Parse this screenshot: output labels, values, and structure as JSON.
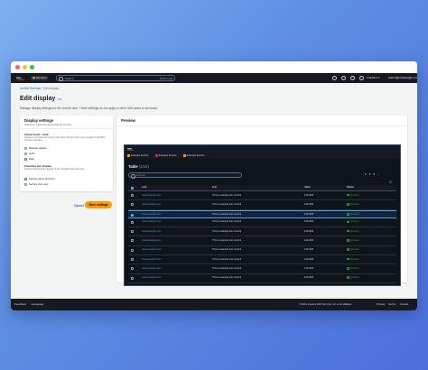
{
  "top_nav": {
    "services": "Services",
    "search_placeholder": "Search",
    "search_shortcut": "[Option+S]",
    "region": "Frankfurt ▾",
    "account": "Admin@nicklaus@m.com ▾"
  },
  "breadcrumb": {
    "root": "Unified Settings",
    "current": "Edit display"
  },
  "page": {
    "title": "Edit display",
    "info": "Info",
    "description": "Manage display settings for the current user. These settings do not apply to other IAM users or accounts."
  },
  "display_settings": {
    "title": "Display settings",
    "subtitle": "Selections made here will update the preview.",
    "visual_mode_label": "Visual mode - beta",
    "visual_mode_hint": "Choose your preferred visual mode. Beta: Visual mode may not apply to all AWS services consoles.",
    "visual_mode_options": [
      "Browser default",
      "Light",
      "Dark"
    ],
    "visual_mode_selected": "Dark",
    "favorites_label": "Favorites bar display",
    "favorites_hint": "Choose how favorites appear in the navigation favorites bar.",
    "favorites_options": [
      "Service name and icon",
      "Service icon only"
    ],
    "favorites_selected": "Service name and icon"
  },
  "actions": {
    "cancel": "Cancel",
    "save": "Save settings"
  },
  "preview": {
    "title": "Preview",
    "tabs": [
      "Example Service",
      "Example Service",
      "Example Service"
    ],
    "table_title": "Table",
    "table_count": "(1/10)",
    "search_placeholder": "Find text",
    "pages": [
      "1",
      "2",
      "3"
    ],
    "current_page": "1",
    "columns": [
      "Link",
      "Text",
      "Value",
      "Status"
    ],
    "rows": [
      {
        "link": "www.example.com",
        "text": "This is example text content",
        "value": "123.4KB",
        "status": "Success",
        "selected": false
      },
      {
        "link": "www.example.com",
        "text": "This is example text content",
        "value": "123.4KB",
        "status": "Success",
        "selected": false
      },
      {
        "link": "www.example.com",
        "text": "This is example text content",
        "value": "123.4KB",
        "status": "Success",
        "selected": true
      },
      {
        "link": "www.example.com",
        "text": "This is example text content",
        "value": "123.4KB",
        "status": "Success",
        "selected": false
      },
      {
        "link": "www.example.com",
        "text": "This is example text content",
        "value": "123.4KB",
        "status": "Success",
        "selected": false
      },
      {
        "link": "www.example.com",
        "text": "This is example text content",
        "value": "123.4KB",
        "status": "Success",
        "selected": false
      },
      {
        "link": "www.example.com",
        "text": "This is example text content",
        "value": "123.4KB",
        "status": "Success",
        "selected": false
      },
      {
        "link": "www.example.com",
        "text": "This is example text content",
        "value": "123.4KB",
        "status": "Success",
        "selected": false
      },
      {
        "link": "www.example.com",
        "text": "This is example text content",
        "value": "123.4KB",
        "status": "Success",
        "selected": false
      },
      {
        "link": "www.example.com",
        "text": "This is example text content",
        "value": "123.4KB",
        "status": "Success",
        "selected": false
      }
    ]
  },
  "footer": {
    "feedback": "Feedback",
    "language": "Language",
    "copyright": "© 2023, Amazon Web Services, Inc. or its affiliates.",
    "privacy": "Privacy",
    "terms": "Terms",
    "cookies": "Cookie preferences"
  },
  "colors": {
    "accent": "#0972d3",
    "primary_button": "#ff9900",
    "success": "#29ad32",
    "dark_bg": "#0f141a"
  }
}
